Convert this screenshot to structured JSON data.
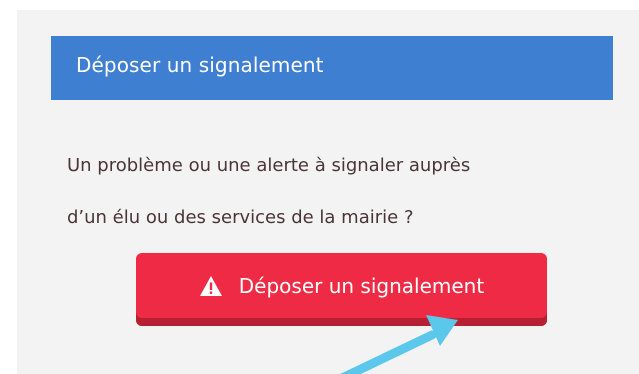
{
  "panel": {
    "header_title": "Déposer un signalement",
    "description_line1": "Un problème ou une alerte à signaler auprès",
    "description_line2": "d’un élu ou des services de la mairie ?",
    "button_label": "Déposer un signalement",
    "button_icon": "warning-icon"
  },
  "colors": {
    "header_bg": "#3f7fd1",
    "button_bg": "#ef2a44",
    "button_shadow": "#b71f32",
    "annotation_arrow": "#5bc7ea",
    "panel_bg": "#f3f3f3",
    "text": "#4a3535"
  },
  "annotation": {
    "icon": "pointer-arrow-icon"
  }
}
